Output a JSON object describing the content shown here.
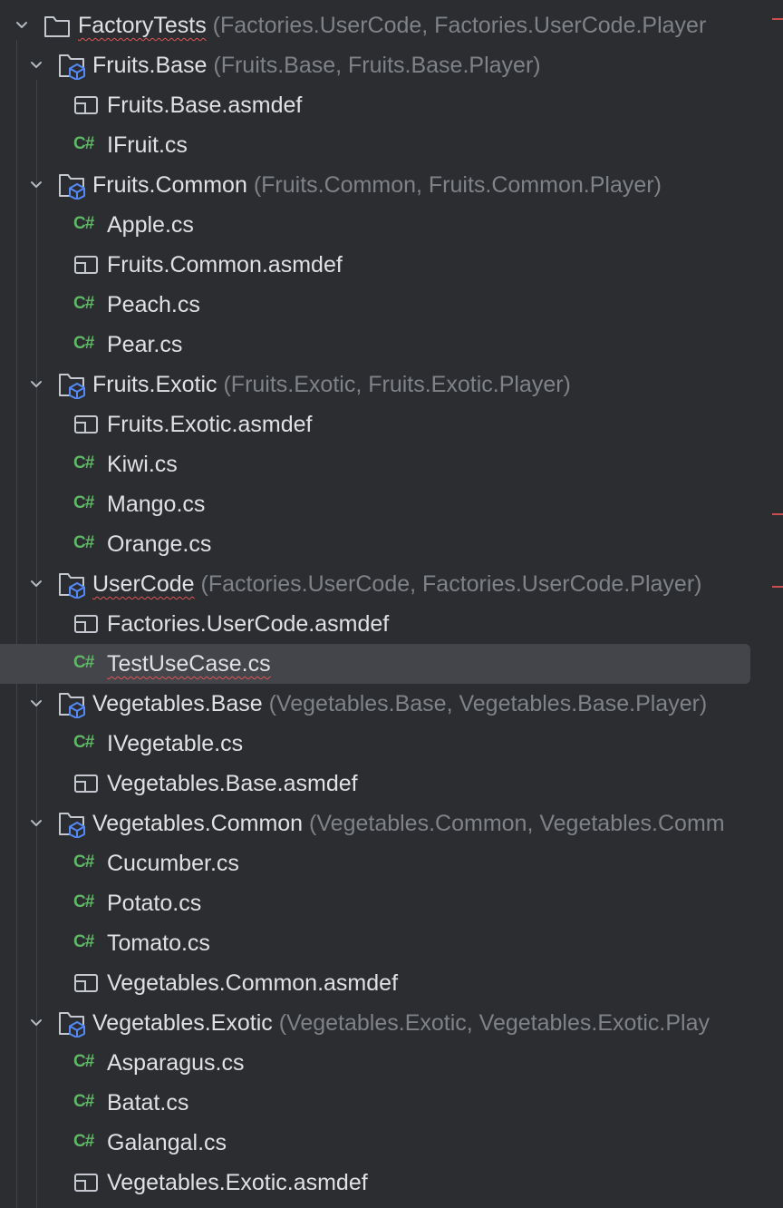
{
  "colors": {
    "background": "#2b2d30",
    "selection": "#43454a",
    "text": "#dfe1e5",
    "hint": "#7f8287",
    "csharp_icon": "#5fb865",
    "module_icon": "#548af7",
    "error": "#e05555"
  },
  "tree": {
    "root": {
      "name": "FactoryTests",
      "hint": "(Factories.UserCode, Factories.UserCode.Player",
      "icon": "folder-icon"
    },
    "rows": [
      {
        "type": "module",
        "name": "Fruits.Base",
        "hint": "(Fruits.Base, Fruits.Base.Player)"
      },
      {
        "type": "asmdef",
        "name": "Fruits.Base.asmdef"
      },
      {
        "type": "cs",
        "name": "IFruit.cs"
      },
      {
        "type": "module",
        "name": "Fruits.Common",
        "hint": "(Fruits.Common, Fruits.Common.Player)"
      },
      {
        "type": "cs",
        "name": "Apple.cs"
      },
      {
        "type": "asmdef",
        "name": "Fruits.Common.asmdef"
      },
      {
        "type": "cs",
        "name": "Peach.cs"
      },
      {
        "type": "cs",
        "name": "Pear.cs"
      },
      {
        "type": "module",
        "name": "Fruits.Exotic",
        "hint": "(Fruits.Exotic, Fruits.Exotic.Player)"
      },
      {
        "type": "asmdef",
        "name": "Fruits.Exotic.asmdef"
      },
      {
        "type": "cs",
        "name": "Kiwi.cs"
      },
      {
        "type": "cs",
        "name": "Mango.cs"
      },
      {
        "type": "cs",
        "name": "Orange.cs"
      },
      {
        "type": "module",
        "name": "UserCode",
        "hint": "(Factories.UserCode, Factories.UserCode.Player)"
      },
      {
        "type": "asmdef",
        "name": "Factories.UserCode.asmdef"
      },
      {
        "type": "cs",
        "name": "TestUseCase.cs"
      },
      {
        "type": "module",
        "name": "Vegetables.Base",
        "hint": "(Vegetables.Base, Vegetables.Base.Player)"
      },
      {
        "type": "cs",
        "name": "IVegetable.cs"
      },
      {
        "type": "asmdef",
        "name": "Vegetables.Base.asmdef"
      },
      {
        "type": "module",
        "name": "Vegetables.Common",
        "hint": "(Vegetables.Common, Vegetables.Comm"
      },
      {
        "type": "cs",
        "name": "Cucumber.cs"
      },
      {
        "type": "cs",
        "name": "Potato.cs"
      },
      {
        "type": "cs",
        "name": "Tomato.cs"
      },
      {
        "type": "asmdef",
        "name": "Vegetables.Common.asmdef"
      },
      {
        "type": "module",
        "name": "Vegetables.Exotic",
        "hint": "(Vegetables.Exotic, Vegetables.Exotic.Play"
      },
      {
        "type": "cs",
        "name": "Asparagus.cs"
      },
      {
        "type": "cs",
        "name": "Batat.cs"
      },
      {
        "type": "cs",
        "name": "Galangal.cs"
      },
      {
        "type": "asmdef",
        "name": "Vegetables.Exotic.asmdef"
      }
    ],
    "cs_icon_label": "C#",
    "selected_row": "TestUseCase.cs",
    "error_underlined": [
      "FactoryTests",
      "UserCode",
      "TestUseCase.cs"
    ]
  }
}
